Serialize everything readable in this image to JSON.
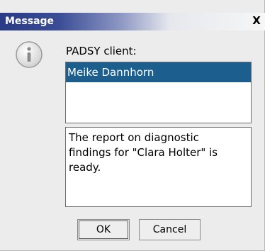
{
  "window": {
    "title": "Message",
    "close_glyph": "X"
  },
  "icon": {
    "name": "info-icon"
  },
  "prompt_label": "PADSY client:",
  "clients": {
    "items": [
      {
        "label": "Meike Dannhorn",
        "selected": true
      }
    ]
  },
  "message": {
    "line1": "The report on diagnostic",
    "line2": "findings for \"Clara Holter\" is",
    "line3": "ready."
  },
  "buttons": {
    "ok_label": "OK",
    "cancel_label": "Cancel"
  },
  "colors": {
    "title_gradient_start": "#2a3b86",
    "selection": "#1c5f8e",
    "dialog_bg": "#ececec"
  }
}
